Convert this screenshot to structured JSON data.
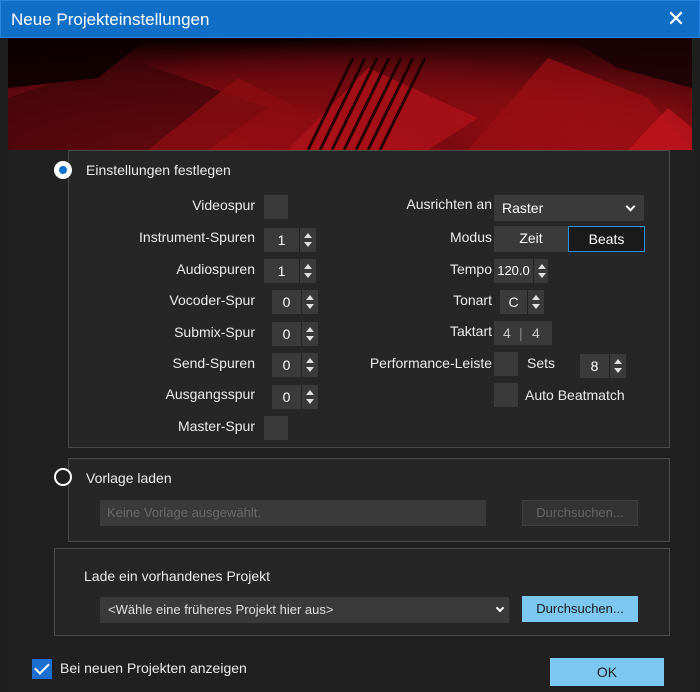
{
  "window": {
    "title": "Neue Projekteinstellungen",
    "close_glyph": "✕"
  },
  "settings": {
    "radio_label": "Einstellungen festlegen",
    "rows_left": [
      {
        "label": "Videospur",
        "type": "checkbox"
      },
      {
        "label": "Instrument-Spuren",
        "type": "spin",
        "value": "1"
      },
      {
        "label": "Audiospuren",
        "type": "spin",
        "value": "1"
      },
      {
        "label": "Vocoder-Spur",
        "type": "spin",
        "value": "0"
      },
      {
        "label": "Submix-Spur",
        "type": "spin",
        "value": "0"
      },
      {
        "label": "Send-Spuren",
        "type": "spin",
        "value": "0"
      },
      {
        "label": "Ausgangsspur",
        "type": "spin",
        "value": "0"
      },
      {
        "label": "Master-Spur",
        "type": "checkbox"
      }
    ],
    "ausrichten": {
      "label": "Ausrichten an",
      "value": "Raster"
    },
    "modus": {
      "label": "Modus",
      "options": [
        "Zeit",
        "Beats"
      ],
      "selected": "Beats"
    },
    "tempo": {
      "label": "Tempo",
      "value": "120.0"
    },
    "tonart": {
      "label": "Tonart",
      "value": "C"
    },
    "taktart": {
      "label": "Taktart",
      "numerator": "4",
      "separator": "|",
      "denominator": "4"
    },
    "performance": {
      "label": "Performance-Leiste",
      "sets_label": "Sets",
      "sets_value": "8"
    },
    "auto_beatmatch": {
      "label": "Auto Beatmatch"
    }
  },
  "template": {
    "radio_label": "Vorlage laden",
    "input_placeholder": "Keine Vorlage ausgewählt.",
    "browse_label": "Durchsuchen..."
  },
  "existing": {
    "title": "Lade ein vorhandenes Projekt",
    "select_value": "<Wähle eine früheres Projekt hier aus>",
    "browse_label": "Durchsuchen..."
  },
  "footer": {
    "show_label": "Bei neuen Projekten anzeigen",
    "ok_label": "OK"
  },
  "colors": {
    "title_bar": "#0f6fc6",
    "accent": "#7cc8f2",
    "panel_bg": "#262626"
  }
}
